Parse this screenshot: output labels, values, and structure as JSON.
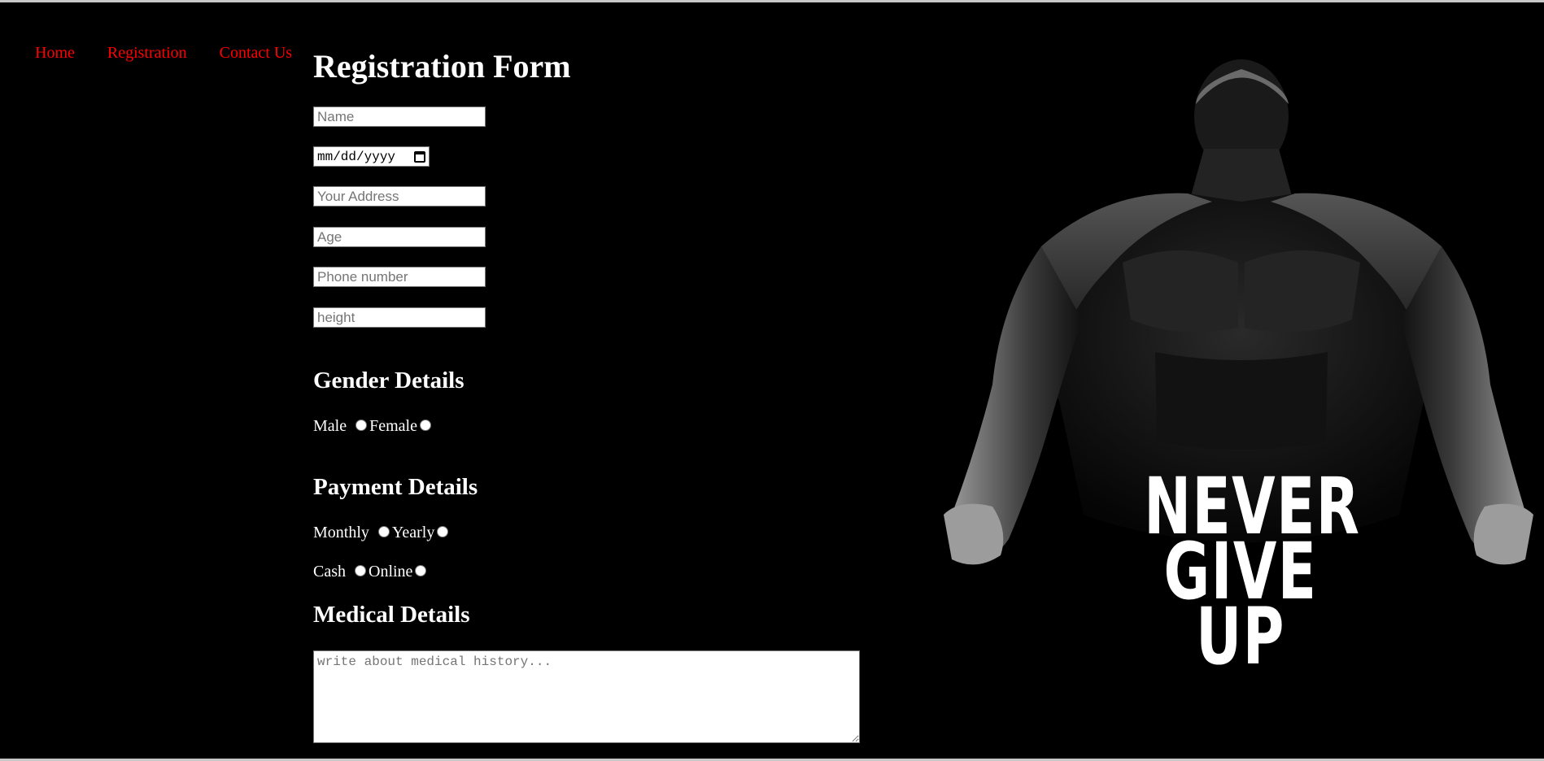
{
  "nav": {
    "items": [
      "Home",
      "Registration",
      "Contact Us"
    ]
  },
  "form": {
    "title": "Registration Form",
    "name_placeholder": "Name",
    "date_placeholder": "mm/dd/yyyy",
    "address_placeholder": "Your Address",
    "age_placeholder": "Age",
    "phone_placeholder": "Phone number",
    "height_placeholder": "height"
  },
  "gender": {
    "heading": "Gender Details",
    "option1": "Male",
    "option2": "Female"
  },
  "payment": {
    "heading": "Payment Details",
    "plan1": "Monthly",
    "plan2": "Yearly",
    "method1": "Cash",
    "method2": "Online"
  },
  "medical": {
    "heading": "Medical Details",
    "placeholder": "write about medical history..."
  },
  "hero": {
    "line1": "NEVER",
    "line2": "GIVE",
    "line3": "UP"
  },
  "colors": {
    "background": "#000000",
    "nav_link": "#ff0000",
    "text": "#ffffff"
  },
  "icons": {
    "date_picker": "calendar-icon"
  }
}
